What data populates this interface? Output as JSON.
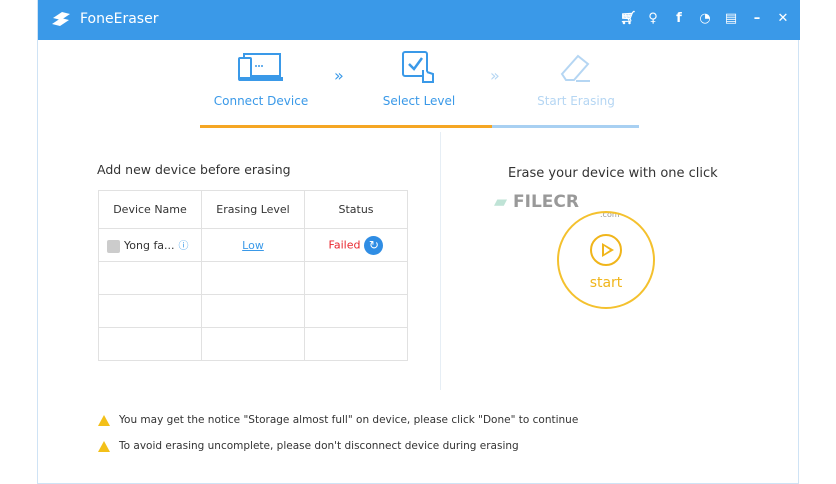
{
  "app": {
    "title": "FoneEraser"
  },
  "titlebar_icons": [
    "cart-icon",
    "key-icon",
    "facebook-icon",
    "chat-icon",
    "feedback-icon",
    "minimize-icon",
    "close-icon"
  ],
  "steps": [
    {
      "label": "Connect Device",
      "state": "done"
    },
    {
      "label": "Select Level",
      "state": "active"
    },
    {
      "label": "Start Erasing",
      "state": "pending"
    }
  ],
  "progress": {
    "fraction": 0.66,
    "fill_color": "#f5a623",
    "track_color": "#a8d0f2"
  },
  "left": {
    "heading": "Add new device before erasing",
    "columns": [
      "Device Name",
      "Erasing Level",
      "Status"
    ],
    "rows": [
      {
        "device": "Yong fa...",
        "level": "Low",
        "status": "Failed"
      }
    ]
  },
  "right": {
    "heading": "Erase your device with one click",
    "start_label": "start",
    "watermark": "FILECR",
    "watermark_sub": ".com"
  },
  "warnings": [
    "You may get the notice \"Storage almost full\" on device, please click \"Done\" to continue",
    "To avoid erasing uncomplete, please don't disconnect device during erasing"
  ],
  "colors": {
    "brand": "#3a99e8",
    "accent": "#f0b51b",
    "error": "#e8262d"
  }
}
